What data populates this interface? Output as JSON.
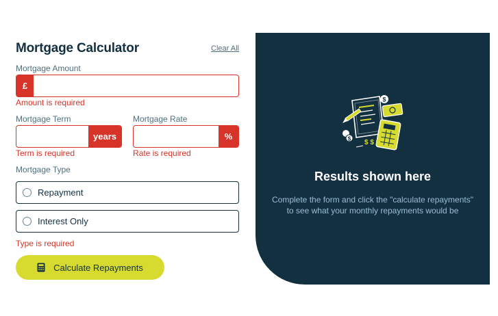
{
  "calculator": {
    "title": "Mortgage Calculator",
    "clear_label": "Clear All",
    "amount": {
      "label": "Mortgage Amount",
      "prefix": "£",
      "value": "",
      "error": "Amount is required"
    },
    "term": {
      "label": "Mortgage Term",
      "suffix": "years",
      "value": "",
      "error": "Term is required"
    },
    "rate": {
      "label": "Mortgage Rate",
      "suffix": "%",
      "value": "",
      "error": "Rate is required"
    },
    "type": {
      "label": "Mortgage Type",
      "options": [
        {
          "label": "Repayment",
          "selected": false
        },
        {
          "label": "Interest Only",
          "selected": false
        }
      ],
      "error": "Type is required"
    },
    "submit_label": "Calculate Repayments",
    "submit_icon": "calculator-icon"
  },
  "results": {
    "illustration": "empty-results-illustration",
    "title": "Results shown here",
    "description": "Complete the form and click the \"calculate repayments\" to see what your monthly repayments would be"
  },
  "colors": {
    "primary": "#133041",
    "accent": "#d8db2f",
    "error": "#d73328",
    "muted": "#4e6e7e",
    "results_text": "#9abed5"
  }
}
